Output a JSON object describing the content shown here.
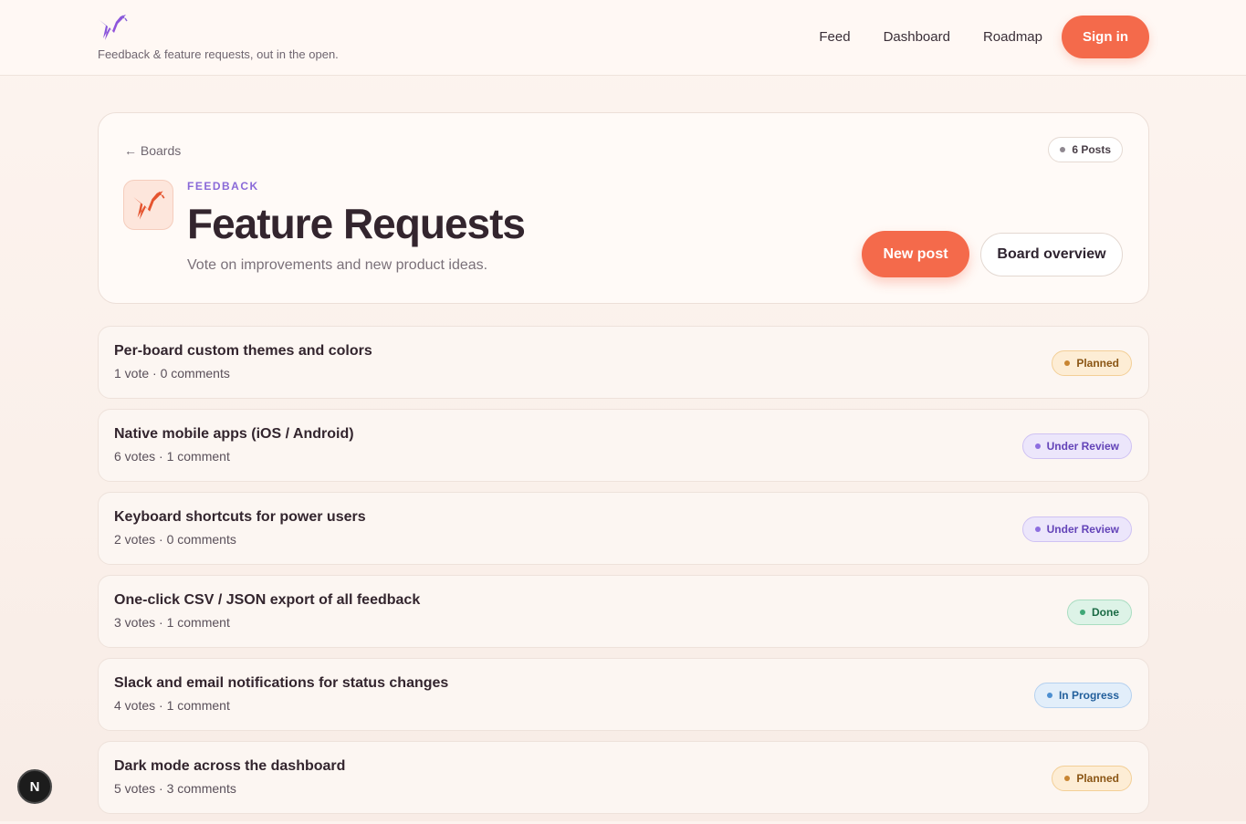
{
  "header": {
    "logo_icon": "hummingbird-logo-icon",
    "tagline": "Feedback & feature requests, out in the open.",
    "nav": [
      "Feed",
      "Dashboard",
      "Roadmap"
    ],
    "signin_label": "Sign in"
  },
  "board": {
    "back_label": "← Boards",
    "posts_count": "6 Posts",
    "eyebrow": "FEEDBACK",
    "title": "Feature Requests",
    "description": "Vote on improvements and new product ideas.",
    "new_post_label": "New post",
    "overview_label": "Board overview"
  },
  "posts": [
    {
      "title": "Per-board custom themes and colors",
      "meta": "1 vote · 0 comments",
      "status": "Planned"
    },
    {
      "title": "Native mobile apps (iOS / Android)",
      "meta": "6 votes · 1 comment",
      "status": "Under Review"
    },
    {
      "title": "Keyboard shortcuts for power users",
      "meta": "2 votes · 0 comments",
      "status": "Under Review"
    },
    {
      "title": "One-click CSV / JSON export of all feedback",
      "meta": "3 votes · 1 comment",
      "status": "Done"
    },
    {
      "title": "Slack and email notifications for status changes",
      "meta": "4 votes · 1 comment",
      "status": "In Progress"
    },
    {
      "title": "Dark mode across the dashboard",
      "meta": "5 votes · 3 comments",
      "status": "Planned"
    }
  ],
  "colors": {
    "accent": "#f46a4b",
    "brand_purple": "#8a6ad8",
    "planned": "#c88532",
    "under_review": "#8d6ee0",
    "done": "#3fa877",
    "in_progress": "#4d8fd1"
  },
  "dev_badge": "N"
}
